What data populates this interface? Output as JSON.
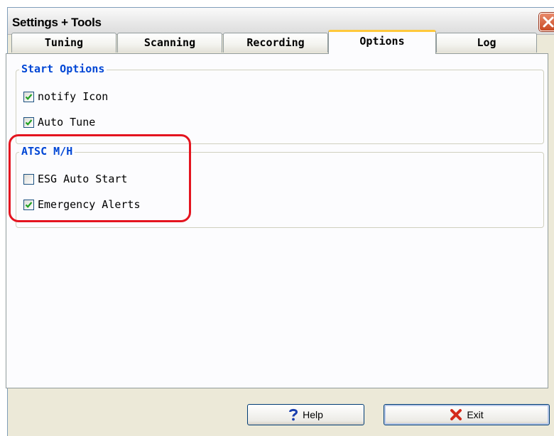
{
  "window": {
    "title": "Settings + Tools"
  },
  "tabs": [
    {
      "label": "Tuning"
    },
    {
      "label": "Scanning"
    },
    {
      "label": "Recording"
    },
    {
      "label": "Options",
      "active": true
    },
    {
      "label": "Log"
    }
  ],
  "start_options": {
    "legend": "Start Options",
    "items": [
      {
        "label": "notify Icon",
        "checked": true
      },
      {
        "label": "Auto Tune",
        "checked": true
      }
    ]
  },
  "atsc_mh": {
    "legend": "ATSC M/H",
    "items": [
      {
        "label": "ESG Auto Start",
        "checked": false
      },
      {
        "label": "Emergency Alerts",
        "checked": true
      }
    ]
  },
  "buttons": {
    "help_label": "Help",
    "exit_label": "Exit"
  },
  "colors": {
    "legend_blue": "#0046d5",
    "active_tab_accent": "#ffc83c",
    "highlight_red": "#e4141f",
    "check_green": "#21a121"
  }
}
